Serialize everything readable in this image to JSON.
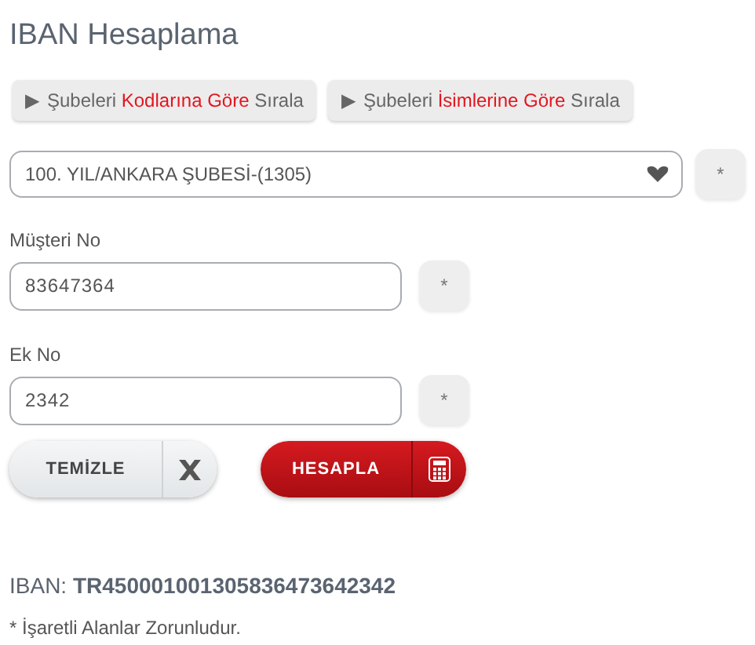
{
  "title": "IBAN Hesaplama",
  "sort_buttons": [
    {
      "icon": "▶",
      "parts": [
        {
          "text": "Şubeleri ",
          "highlight": false
        },
        {
          "text": "Kodlarına Göre",
          "highlight": true
        },
        {
          "text": " Sırala",
          "highlight": false
        }
      ]
    },
    {
      "icon": "▶",
      "parts": [
        {
          "text": "Şubeleri ",
          "highlight": false
        },
        {
          "text": "İsimlerine Göre",
          "highlight": true
        },
        {
          "text": " Sırala",
          "highlight": false
        }
      ]
    }
  ],
  "branch_select": {
    "value": "100. YIL/ANKARA ŞUBESİ-(1305)",
    "required_mark": "*"
  },
  "fields": [
    {
      "label": "Müşteri No",
      "value": "83647364",
      "required_mark": "*"
    },
    {
      "label": "Ek No",
      "value": "2342",
      "required_mark": "*"
    }
  ],
  "actions": [
    {
      "kind": "clear",
      "label": "TEMİZLE"
    },
    {
      "kind": "calculate",
      "label": "HESAPLA"
    }
  ],
  "result": "IBAN: **TR450001001305836473642342**",
  "note": "* İşaretli Alanlar Zorunludur."
}
